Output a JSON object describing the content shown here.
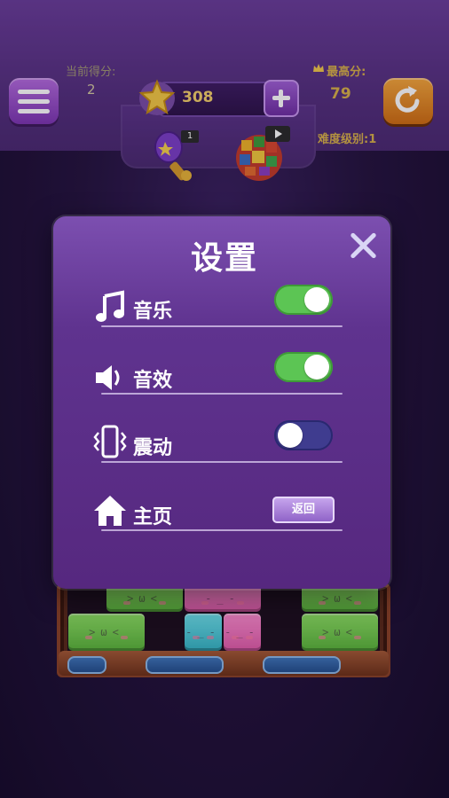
{
  "hud": {
    "current_score_label": "当前得分:",
    "current_score": "2",
    "best_score_label": "最高分:",
    "best_score": "79",
    "difficulty_label": "难度级别:1",
    "coins": "308",
    "hammer_count": "1"
  },
  "settings": {
    "title": "设置",
    "rows": [
      {
        "label": "音乐",
        "icon": "music-note-icon",
        "toggle_on": true
      },
      {
        "label": "音效",
        "icon": "speaker-icon",
        "toggle_on": true
      },
      {
        "label": "震动",
        "icon": "vibrate-phone-icon",
        "toggle_on": false
      },
      {
        "label": "主页",
        "icon": "home-icon"
      }
    ],
    "back_label": "返回"
  },
  "colors": {
    "toggle_on": "#5cc554",
    "toggle_off": "#3f3c8f",
    "gold": "#d8b14a",
    "dialog": "#5f338f"
  }
}
